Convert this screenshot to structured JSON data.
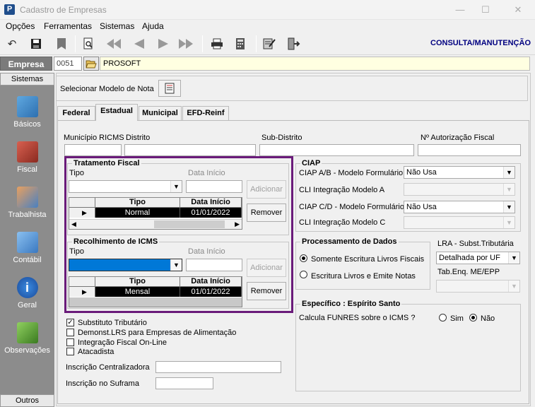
{
  "window": {
    "title": "Cadastro de Empresas",
    "logo": "P"
  },
  "menu": [
    "Opções",
    "Ferramentas",
    "Sistemas",
    "Ajuda"
  ],
  "toolbar": {
    "mode_label": "CONSULTA/MANUTENÇÃO"
  },
  "empresa": {
    "label": "Empresa",
    "code": "0051",
    "name": "PROSOFT"
  },
  "sidebar": {
    "header": "Sistemas",
    "footer": "Outros",
    "items": [
      "Básicos",
      "Fiscal",
      "Trabalhista",
      "Contábil",
      "Geral",
      "Observações"
    ]
  },
  "modelo": {
    "label": "Selecionar Modelo de Nota"
  },
  "tabs": [
    "Federal",
    "Estadual",
    "Municipal",
    "EFD-Reinf"
  ],
  "fields": {
    "municipio_ricms": "Município RICMS",
    "distrito": "Distrito",
    "sub_distrito": "Sub-Distrito",
    "autorizacao": "Nº Autorização Fiscal"
  },
  "tratamento": {
    "title": "Tratamento Fiscal",
    "tipo_label": "Tipo",
    "data_label": "Data Início",
    "add": "Adicionar",
    "remove": "Remover",
    "col_tipo": "Tipo",
    "col_data": "Data Início",
    "row_tipo": "Normal",
    "row_data": "01/01/2022"
  },
  "recolhimento": {
    "title": "Recolhimento de ICMS",
    "tipo_label": "Tipo",
    "data_label": "Data Início",
    "add": "Adicionar",
    "remove": "Remover",
    "col_tipo": "Tipo",
    "col_data": "Data Início",
    "row_tipo": "Mensal",
    "row_data": "01/01/2022"
  },
  "ciap": {
    "title": "CIAP",
    "ab_label": "CIAP  A/B - Modelo Formulário",
    "ab_value": "Não Usa",
    "cli_a_label": "CLI Integração Modelo A",
    "cd_label": "CIAP C/D - Modelo Formulário",
    "cd_value": "Não Usa",
    "cli_c_label": "CLI Integração Modelo C"
  },
  "processamento": {
    "title": "Processamento de Dados",
    "opt1": "Somente Escritura Livros Fiscais",
    "opt2": "Escritura Livros e Emite Notas"
  },
  "lra": {
    "label": "LRA - Subst.Tributária",
    "value": "Detalhada por UF",
    "tab_label": "Tab.Enq. ME/EPP"
  },
  "especifico": {
    "title": "Específico : Espírito Santo",
    "question": "Calcula FUNRES sobre o ICMS ?",
    "sim": "Sim",
    "nao": "Não"
  },
  "checks": {
    "substituto": "Substituto Tributário",
    "demonst": "Demonst.LRS para Empresas de Alimentação",
    "integracao": "Integração Fiscal On-Line",
    "atacadista": "Atacadista"
  },
  "inscricoes": {
    "centralizadora": "Inscrição Centralizadora",
    "suframa": "Inscrição no Suframa"
  }
}
